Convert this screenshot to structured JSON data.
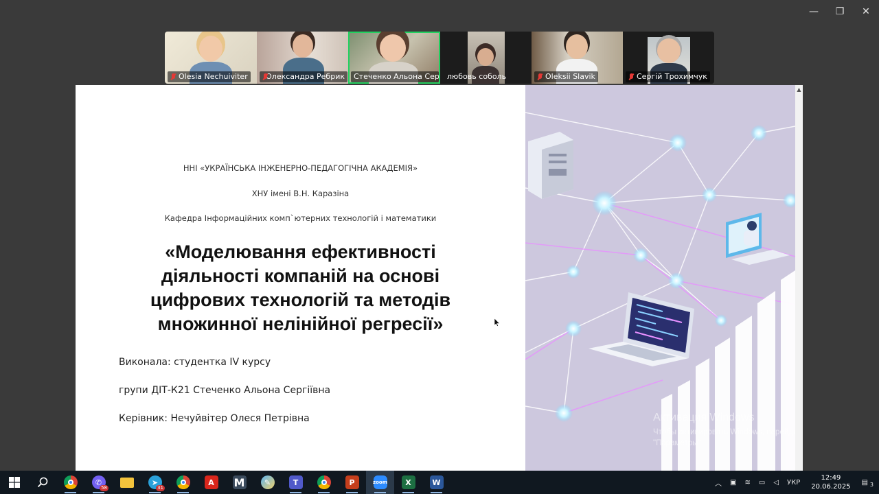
{
  "window": {
    "minimize_glyph": "—",
    "maximize_glyph": "❐",
    "close_glyph": "✕"
  },
  "participants": [
    {
      "name": "Olesia Nechuiviter",
      "muted": true
    },
    {
      "name": "Олександра Ребрик",
      "muted": true
    },
    {
      "name": "Стеченко Альона Сергіїв...",
      "muted": false,
      "active": true
    },
    {
      "name": "любовь соболь",
      "muted": false
    },
    {
      "name": "Oleksii Slavik",
      "muted": true
    },
    {
      "name": "Сергій Трохимчук",
      "muted": true
    }
  ],
  "slide": {
    "institute": "ННІ «УКРАЇНСЬКА ІНЖЕНЕРНО-ПЕДАГОГІЧНА АКАДЕМІЯ»",
    "university": "ХНУ імені В.Н. Каразіна",
    "department": "Кафедра Інформаційних комп`ютерних технологій і математики",
    "title_lines": [
      "«Моделювання ефективності",
      "діяльності компаній на основі",
      "цифрових технологій та методів",
      "множинної нелінійної регресії»"
    ],
    "performer": "Виконала: студентка IV курсу",
    "group": "групи ДІТ-К21 Стеченко Альона Сергіївна",
    "supervisor": "Керівник: Нечуйвітер Олеся Петрівна"
  },
  "watermark": {
    "line1": "Активация Windows",
    "line2": "Чтобы активировать Windows, перейдите в раздел",
    "line3": "\"Параметры\"."
  },
  "taskbar": {
    "badges": {
      "viber": "58",
      "telegram": "31"
    },
    "tray": {
      "language": "УКР",
      "time": "12:49",
      "date": "20.06.2025",
      "notifications": "3"
    }
  },
  "colors": {
    "active_speaker": "#23d160",
    "slide_right_bg": "#cdc8de",
    "taskbar_bg": "#101820"
  }
}
